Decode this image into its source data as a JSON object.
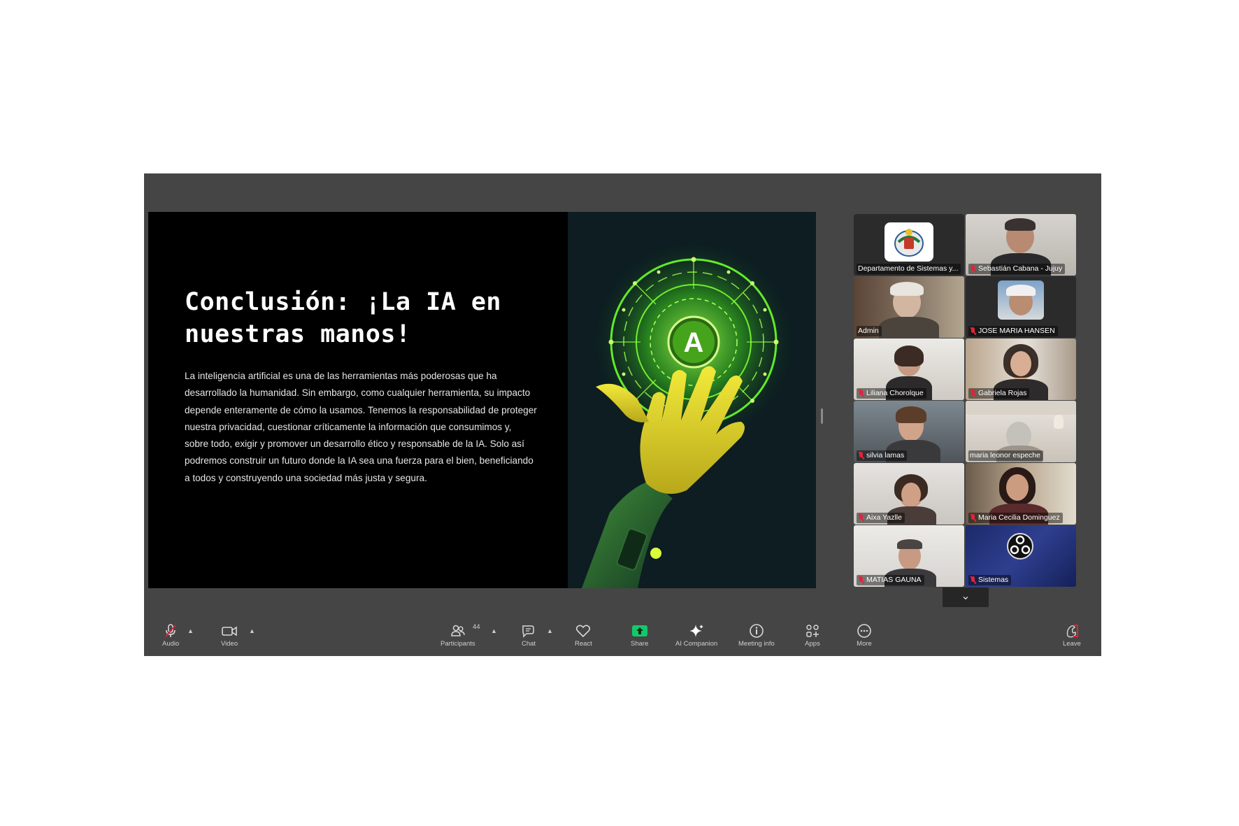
{
  "slide": {
    "title": "Conclusión: ¡La IA en nuestras manos!",
    "body": "La inteligencia artificial es una de las herramientas más poderosas que ha desarrollado la humanidad. Sin embargo, como cualquier herramienta, su impacto depende enteramente de cómo la usamos. Tenemos la responsabilidad de proteger nuestra privacidad, cuestionar críticamente la información que consumimos y, sobre todo, exigir y promover un desarrollo ético y responsable de la IA. Solo así podremos construir un futuro donde la IA sea una fuerza para el bien, beneficiando a todos y construyendo una sociedad más justa y segura.",
    "art_badge_letter": "A"
  },
  "participants": [
    {
      "name": "Departamento de Sistemas y...",
      "active": true
    },
    {
      "name": "Sebastián Cabana - Jujuy"
    },
    {
      "name": "Admin"
    },
    {
      "name": "JOSE MARIA HANSEN"
    },
    {
      "name": "Liliana Chorolque"
    },
    {
      "name": "Gabriela Rojas"
    },
    {
      "name": "silvia lamas"
    },
    {
      "name": "maria leonor espeche"
    },
    {
      "name": "Aixa Yazlle"
    },
    {
      "name": "Maria Cecilia Dominguez"
    },
    {
      "name": "MATIAS GAUNA"
    },
    {
      "name": "Sistemas"
    }
  ],
  "toolbar": {
    "audio": "Audio",
    "video": "Video",
    "participants": "Participants",
    "participants_count": "44",
    "chat": "Chat",
    "react": "React",
    "share": "Share",
    "ai_companion": "AI Companion",
    "meeting_info": "Meeting info",
    "apps": "Apps",
    "more": "More",
    "leave": "Leave"
  },
  "colors": {
    "window_bg": "#454545",
    "active_speaker": "#1ed760",
    "share_green": "#12c96a",
    "muted_red": "#e0243a",
    "slide_accent_green": "#8dff3a",
    "hand_yellow": "#e8dc2a"
  }
}
